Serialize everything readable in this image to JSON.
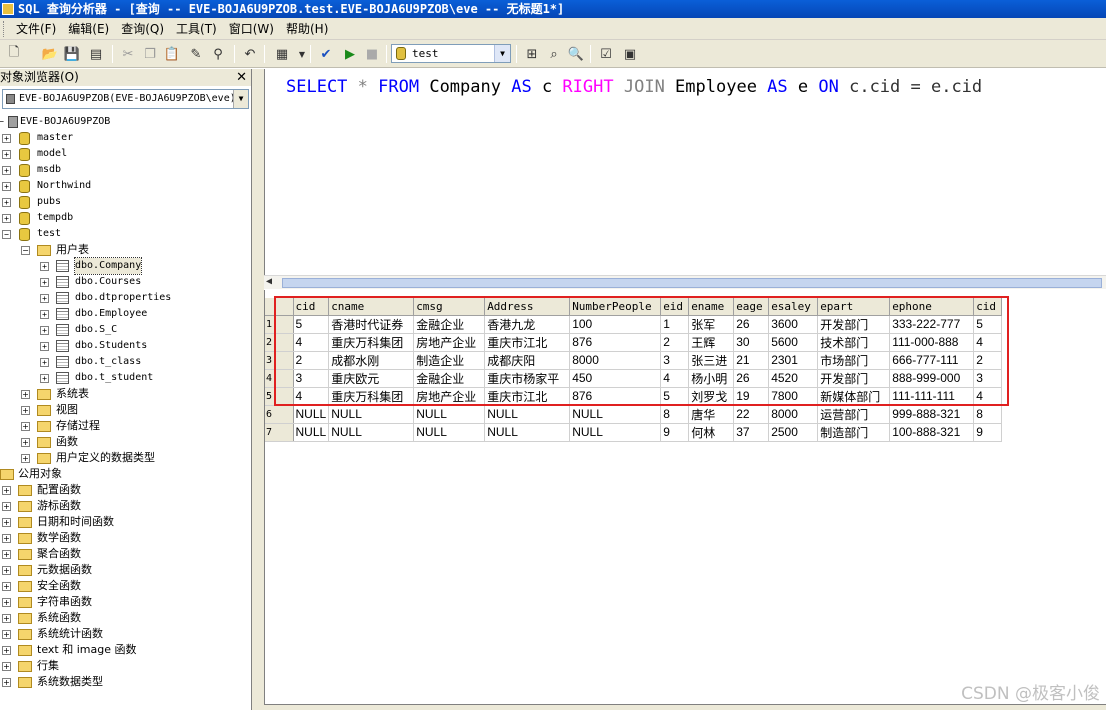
{
  "window": {
    "title": "SQL 查询分析器 - [查询 -- EVE-BOJA6U9PZOB.test.EVE-BOJA6U9PZOB\\eve -- 无标题1*]"
  },
  "menu": {
    "items": [
      "文件(F)",
      "编辑(E)",
      "查询(Q)",
      "工具(T)",
      "窗口(W)",
      "帮助(H)"
    ]
  },
  "toolbar": {
    "database": "test",
    "icons": [
      "new-query-icon",
      "open-icon",
      "save-icon",
      "load-script-icon",
      "cut-icon",
      "copy-icon",
      "paste-icon",
      "clear-icon",
      "find-icon",
      "undo-icon",
      "results-mode-icon",
      "parse-icon",
      "execute-icon",
      "stop-icon",
      "object-browser-icon",
      "object-search-icon",
      "properties-icon"
    ]
  },
  "object_browser": {
    "title": "对象浏览器(O)",
    "server_combo": "EVE-BOJA6U9PZOB(EVE-BOJA6U9PZOB\\eve)",
    "server": "EVE-BOJA6U9PZOB",
    "databases": [
      "master",
      "model",
      "msdb",
      "Northwind",
      "pubs",
      "tempdb",
      "test"
    ],
    "user_tables_folder": "用户表",
    "tables": [
      "dbo.Company",
      "dbo.Courses",
      "dbo.dtproperties",
      "dbo.Employee",
      "dbo.S_C",
      "dbo.Students",
      "dbo.t_class",
      "dbo.t_student"
    ],
    "test_folders": [
      "系统表",
      "视图",
      "存储过程",
      "函数",
      "用户定义的数据类型"
    ],
    "common_objects": "公用对象",
    "common_folders": [
      "配置函数",
      "游标函数",
      "日期和时间函数",
      "数学函数",
      "聚合函数",
      "元数据函数",
      "安全函数",
      "字符串函数",
      "系统函数",
      "系统统计函数",
      "text 和 image 函数",
      "行集",
      "系统数据类型"
    ]
  },
  "editor": {
    "sql": {
      "select": "SELECT",
      "star": " * ",
      "from": "FROM",
      "company": " Company ",
      "as1": "AS",
      "c": " c ",
      "right": "RIGHT",
      "sp1": " ",
      "join": "JOIN",
      "employee": " Employee ",
      "as2": "AS",
      "e": " e ",
      "on": "ON",
      "cond": " c.cid = e.cid"
    }
  },
  "results": {
    "columns": [
      "cid",
      "cname",
      "cmsg",
      "Address",
      "NumberPeople",
      "eid",
      "ename",
      "eage",
      "esaley",
      "epart",
      "ephone",
      "cid"
    ],
    "rows": [
      [
        "1",
        "5",
        "香港时代证券",
        "金融企业",
        "香港九龙",
        "100",
        "1",
        "张军",
        "26",
        "3600",
        "开发部门",
        "333-222-777",
        "5"
      ],
      [
        "2",
        "4",
        "重庆万科集团",
        "房地产企业",
        "重庆市江北",
        "876",
        "2",
        "王辉",
        "30",
        "5600",
        "技术部门",
        "111-000-888",
        "4"
      ],
      [
        "3",
        "2",
        "成都水刚",
        "制造企业",
        "成都庆阳",
        "8000",
        "3",
        "张三进",
        "21",
        "2301",
        "市场部门",
        "666-777-111",
        "2"
      ],
      [
        "4",
        "3",
        "重庆欧元",
        "金融企业",
        "重庆市杨家平",
        "450",
        "4",
        "杨小明",
        "26",
        "4520",
        "开发部门",
        "888-999-000",
        "3"
      ],
      [
        "5",
        "4",
        "重庆万科集团",
        "房地产企业",
        "重庆市江北",
        "876",
        "5",
        "刘罗戈",
        "19",
        "7800",
        "新媒体部门",
        "111-111-111",
        "4"
      ],
      [
        "6",
        "NULL",
        "NULL",
        "NULL",
        "NULL",
        "NULL",
        "8",
        "唐华",
        "22",
        "8000",
        "运营部门",
        "999-888-321",
        "8"
      ],
      [
        "7",
        "NULL",
        "NULL",
        "NULL",
        "NULL",
        "NULL",
        "9",
        "何林",
        "37",
        "2500",
        "制造部门",
        "100-888-321",
        "9"
      ]
    ]
  },
  "watermark": "CSDN @极客小俊",
  "colors": {
    "keyword": "#0000ff",
    "join_keyword": "#ff00ff",
    "highlight_box": "#e02020"
  }
}
